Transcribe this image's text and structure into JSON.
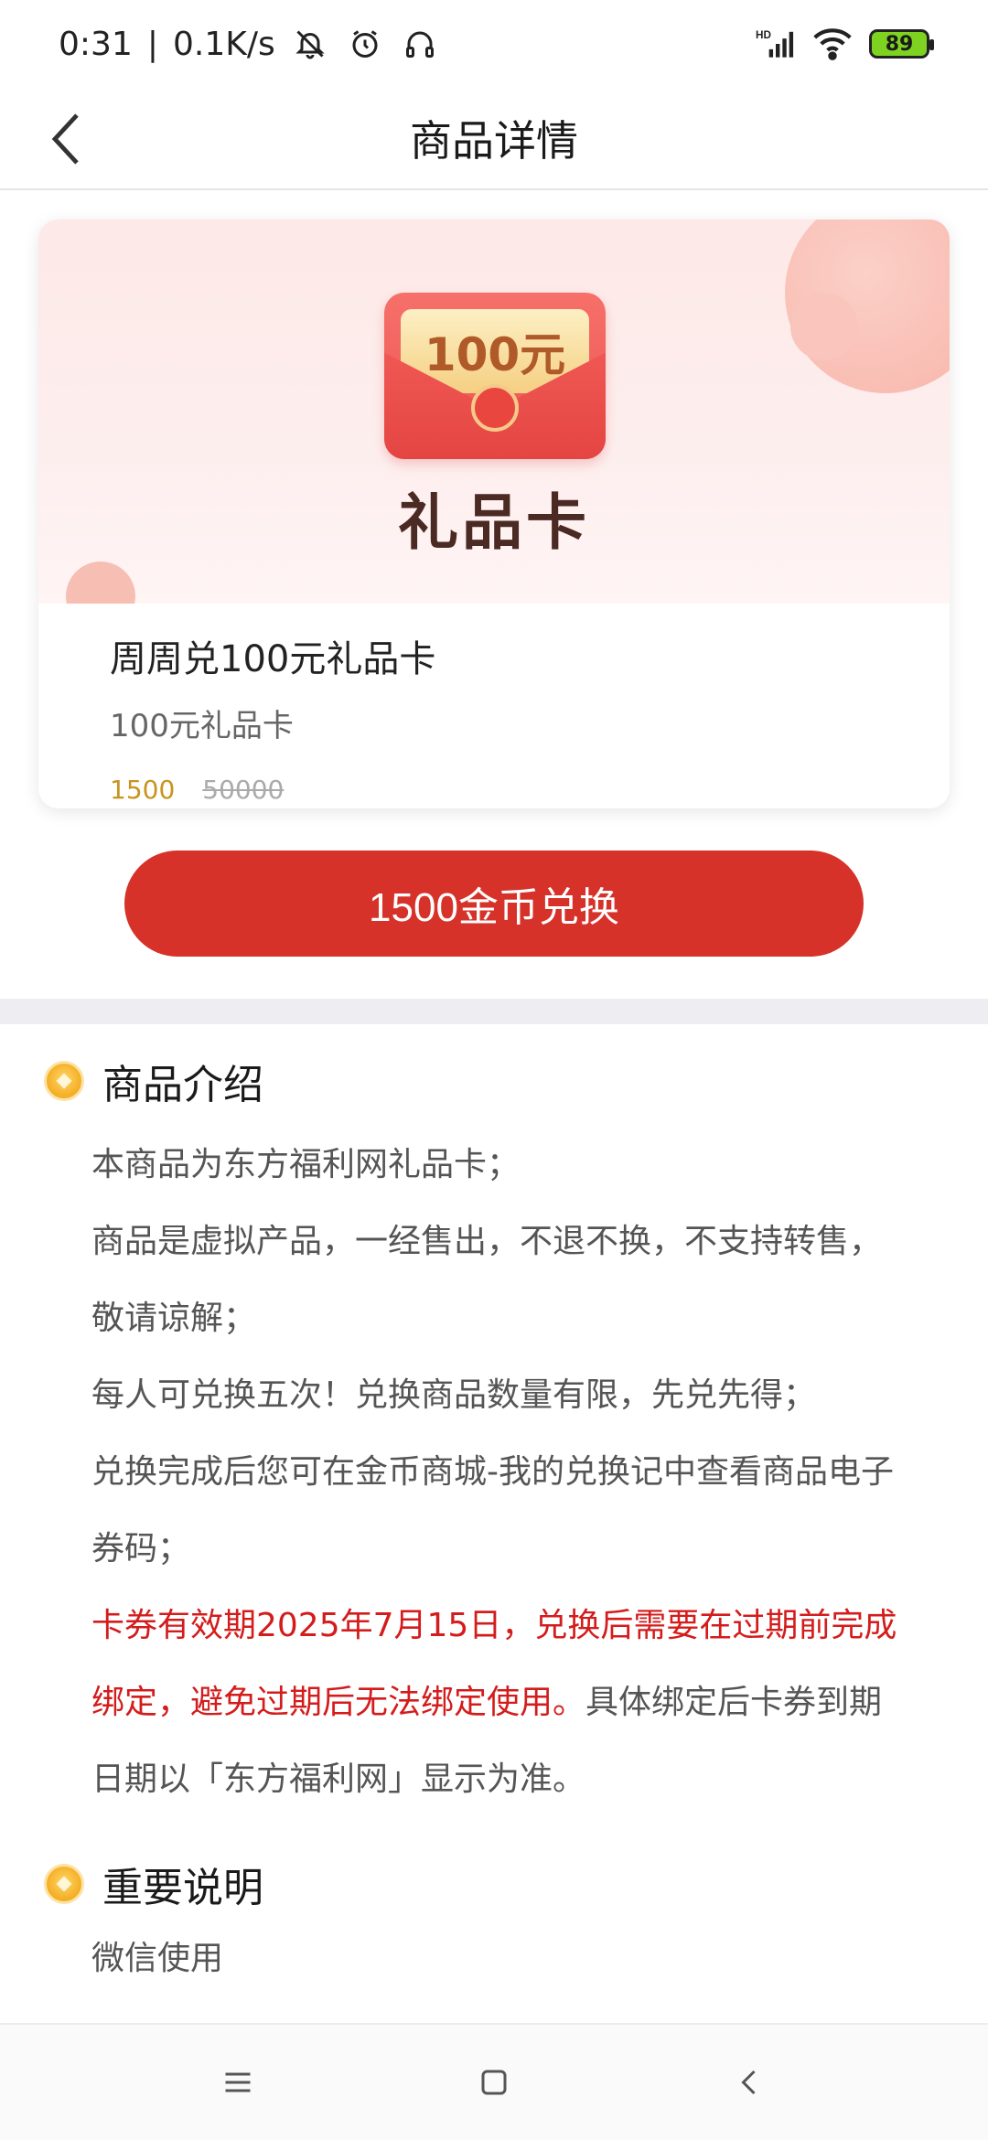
{
  "status_bar": {
    "time": "0:31",
    "separator": "|",
    "speed": "0.1K/s",
    "battery": "89",
    "icons": [
      "mute-bell-icon",
      "alarm-icon",
      "headset-icon",
      "hd-signal-icon",
      "wifi-icon",
      "battery-icon"
    ]
  },
  "header": {
    "title": "商品详情",
    "back_icon": "chevron-left-icon"
  },
  "product": {
    "banner_amount": "100元",
    "banner_label": "礼品卡",
    "name": "周周兑100元礼品卡",
    "subtitle": "100元礼品卡",
    "price_now": "1500",
    "price_old": "50000"
  },
  "exchange_button": {
    "label": "1500金币兑换",
    "color": "#d6322a"
  },
  "intro": {
    "title": "商品介绍",
    "lines": [
      "本商品为东方福利网礼品卡；",
      "商品是虚拟产品，一经售出，不退不换，不支持转售，敬请谅解；",
      "每人可兑换五次！兑换商品数量有限，先兑先得；",
      "兑换完成后您可在金币商城-我的兑换记中查看商品电子券码；"
    ],
    "red_text": "卡券有效期2025年7月15日，兑换后需要在过期前完成绑定，避免过期后无法绑定使用。",
    "tail_text": "具体绑定后卡券到期日期以「东方福利网」显示为准。"
  },
  "notes": {
    "title": "重要说明",
    "text": "微信使用"
  },
  "bottom_nav": {
    "icons": [
      "menu-icon",
      "home-square-icon",
      "back-triangle-icon"
    ]
  },
  "colors": {
    "accent_red": "#d6322a",
    "price_gold": "#c8941f",
    "warning_red": "#d41c1c"
  }
}
